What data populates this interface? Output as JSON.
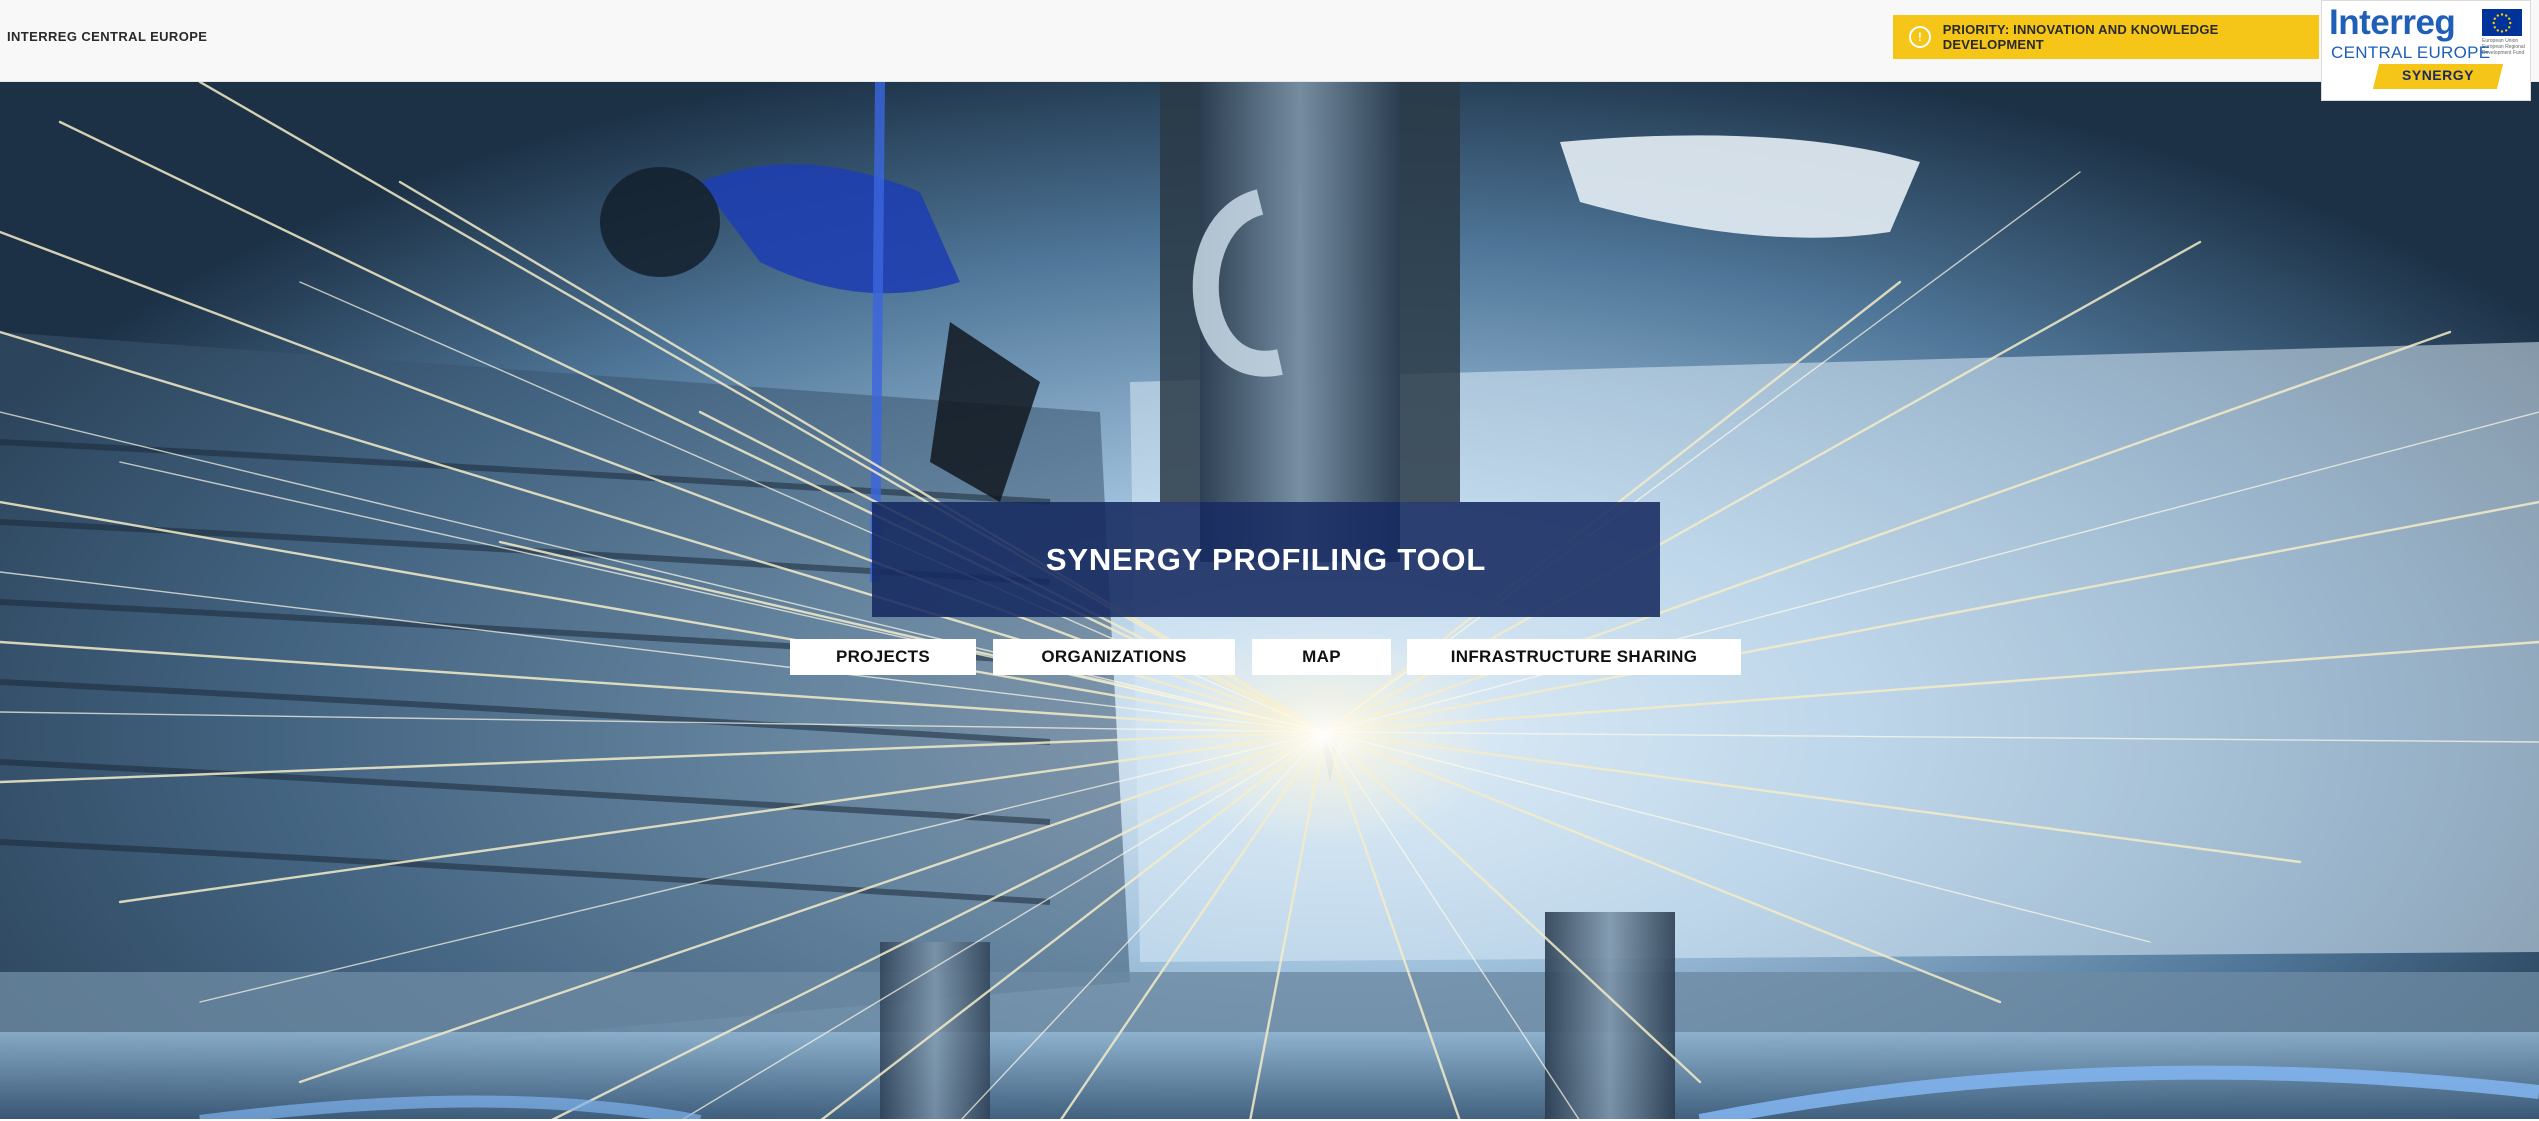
{
  "header": {
    "site_title": "INTERREG CENTRAL EUROPE",
    "priority_icon": "lightbulb-icon",
    "priority_label": "PRIORITY: INNOVATION AND KNOWLEDGE DEVELOPMENT",
    "logo": {
      "brand": "Interreg",
      "region": "CENTRAL EUROPE",
      "eu_text": "European Union European Regional Development Fund",
      "project": "SYNERGY"
    }
  },
  "hero": {
    "title": "SYNERGY PROFILING TOOL",
    "nav": {
      "projects": "PROJECTS",
      "organizations": "ORGANIZATIONS",
      "map": "MAP",
      "infrastructure": "INFRASTRUCTURE SHARING"
    }
  },
  "colors": {
    "accent_yellow": "#f5c518",
    "title_navy": "#162960",
    "logo_blue": "#1f5fb8"
  }
}
